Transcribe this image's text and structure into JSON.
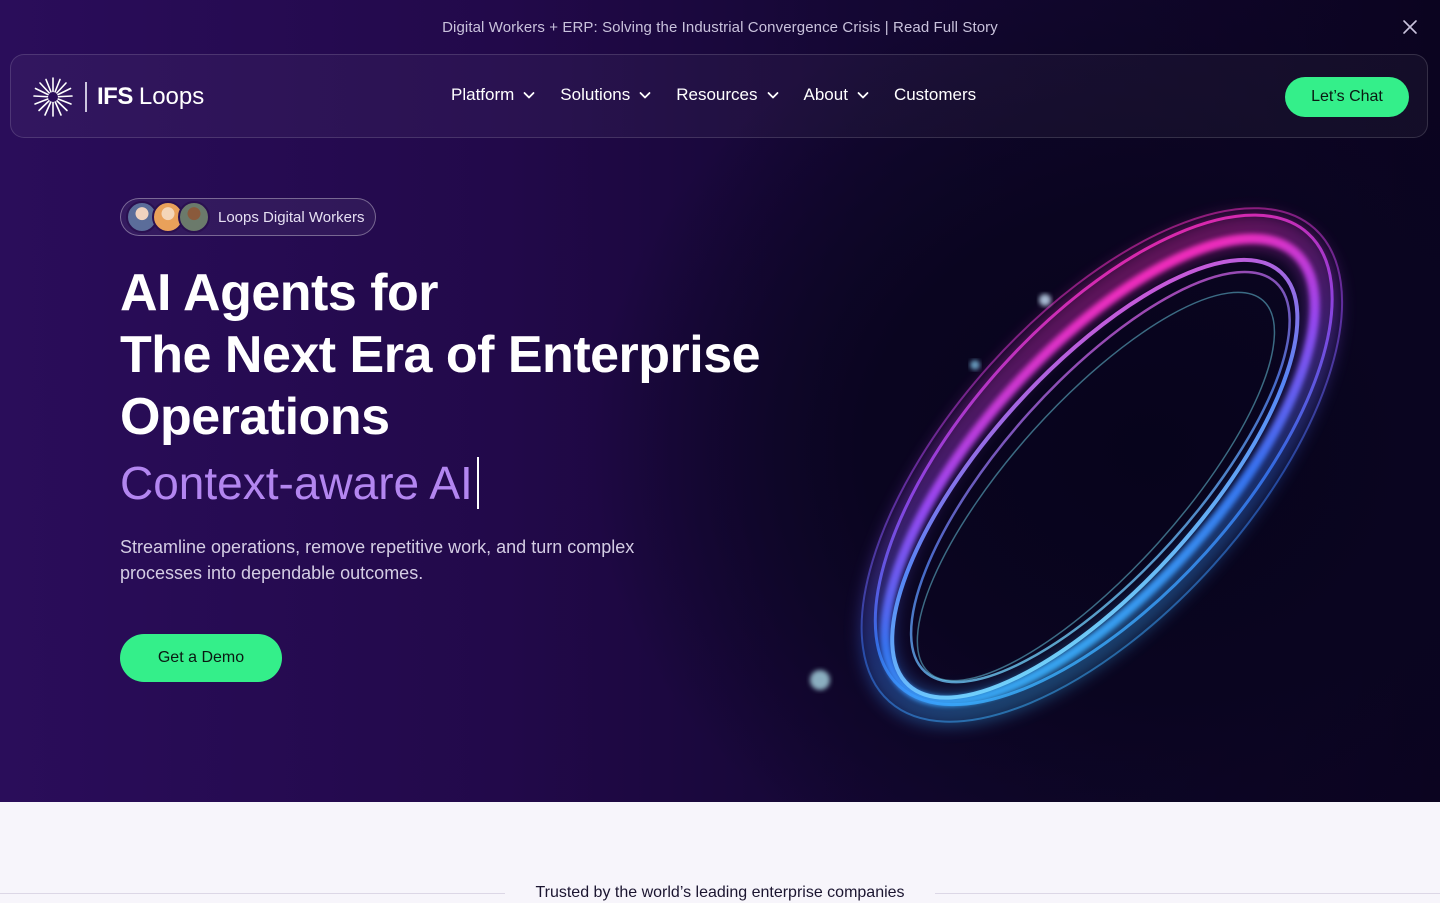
{
  "announcement": {
    "text": "Digital Workers + ERP: Solving the Industrial Convergence Crisis | Read Full Story"
  },
  "nav": {
    "logo_ifs": "IFS",
    "logo_loops": "Loops",
    "items": [
      {
        "label": "Platform",
        "has_dropdown": true
      },
      {
        "label": "Solutions",
        "has_dropdown": true
      },
      {
        "label": "Resources",
        "has_dropdown": true
      },
      {
        "label": "About",
        "has_dropdown": true
      },
      {
        "label": "Customers",
        "has_dropdown": false
      }
    ],
    "cta": "Let’s Chat"
  },
  "hero": {
    "badge": "Loops Digital Workers",
    "headline_lines": [
      "AI Agents for",
      "The Next Era of Enterprise",
      "Operations"
    ],
    "typed_text": "Context-aware AI",
    "subtitle": "Streamline operations, remove repetitive work, and turn complex processes into dependable outcomes.",
    "cta": "Get a Demo"
  },
  "trusted": {
    "text": "Trusted by the world’s leading enterprise companies"
  },
  "colors": {
    "accent_green": "#34ef8a",
    "typed_purple": "#b386f0",
    "hero_bg": "#22094a"
  },
  "icons": [
    "close-icon",
    "chevron-down-icon",
    "ifs-loops-logo"
  ]
}
